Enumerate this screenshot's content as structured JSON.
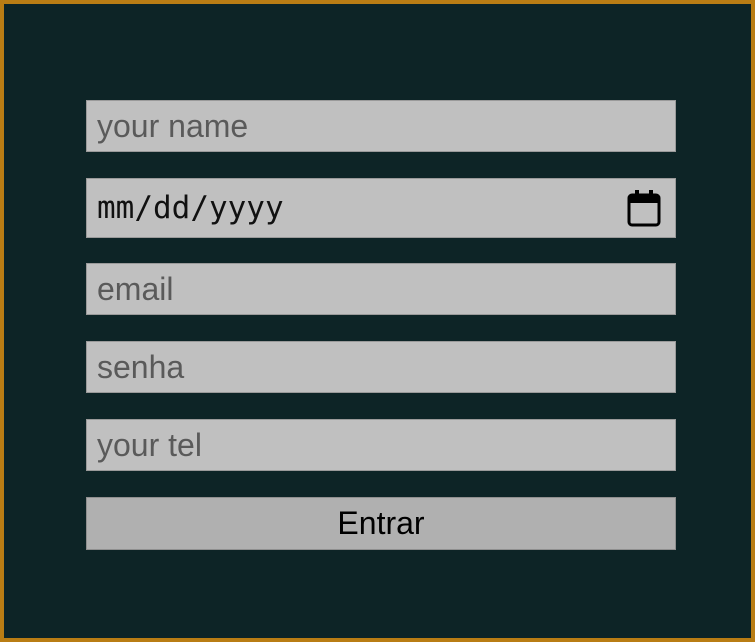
{
  "form": {
    "name_placeholder": "your name",
    "date_placeholder": "mm/dd/yyyy",
    "email_placeholder": "email",
    "password_placeholder": "senha",
    "tel_placeholder": "your tel",
    "submit_label": "Entrar"
  },
  "icons": {
    "date_picker": "calendar-icon"
  },
  "colors": {
    "page_background": "#0d2426",
    "frame_border": "#b97d14",
    "field_background": "#c0c0c0",
    "button_background": "#b0b0b0",
    "placeholder_text": "#5a5a5a"
  }
}
